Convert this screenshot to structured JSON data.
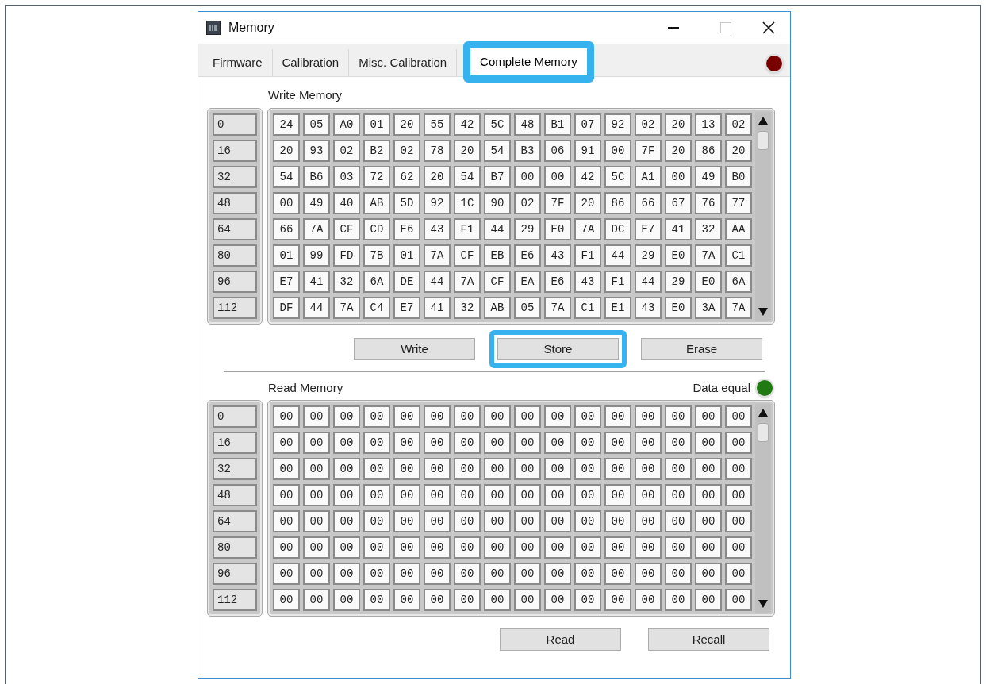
{
  "window": {
    "title": "Memory"
  },
  "tabs": [
    {
      "label": "Firmware",
      "selected": false,
      "highlighted": false
    },
    {
      "label": "Calibration",
      "selected": false,
      "highlighted": false
    },
    {
      "label": "Misc. Calibration",
      "selected": false,
      "highlighted": false
    },
    {
      "label": "Complete Memory",
      "selected": true,
      "highlighted": true
    }
  ],
  "connection_led": {
    "color": "#7a0000"
  },
  "write_memory": {
    "label": "Write Memory",
    "addresses": [
      "0",
      "16",
      "32",
      "48",
      "64",
      "80",
      "96",
      "112"
    ],
    "rows": [
      [
        "24",
        "05",
        "A0",
        "01",
        "20",
        "55",
        "42",
        "5C",
        "48",
        "B1",
        "07",
        "92",
        "02",
        "20",
        "13",
        "02"
      ],
      [
        "20",
        "93",
        "02",
        "B2",
        "02",
        "78",
        "20",
        "54",
        "B3",
        "06",
        "91",
        "00",
        "7F",
        "20",
        "86",
        "20"
      ],
      [
        "54",
        "B6",
        "03",
        "72",
        "62",
        "20",
        "54",
        "B7",
        "00",
        "00",
        "42",
        "5C",
        "A1",
        "00",
        "49",
        "B0"
      ],
      [
        "00",
        "49",
        "40",
        "AB",
        "5D",
        "92",
        "1C",
        "90",
        "02",
        "7F",
        "20",
        "86",
        "66",
        "67",
        "76",
        "77"
      ],
      [
        "66",
        "7A",
        "CF",
        "CD",
        "E6",
        "43",
        "F1",
        "44",
        "29",
        "E0",
        "7A",
        "DC",
        "E7",
        "41",
        "32",
        "AA"
      ],
      [
        "01",
        "99",
        "FD",
        "7B",
        "01",
        "7A",
        "CF",
        "EB",
        "E6",
        "43",
        "F1",
        "44",
        "29",
        "E0",
        "7A",
        "C1"
      ],
      [
        "E7",
        "41",
        "32",
        "6A",
        "DE",
        "44",
        "7A",
        "CF",
        "EA",
        "E6",
        "43",
        "F1",
        "44",
        "29",
        "E0",
        "6A"
      ],
      [
        "DF",
        "44",
        "7A",
        "C4",
        "E7",
        "41",
        "32",
        "AB",
        "05",
        "7A",
        "C1",
        "E1",
        "43",
        "E0",
        "3A",
        "7A"
      ]
    ]
  },
  "write_buttons": [
    {
      "label": "Write",
      "highlighted": false
    },
    {
      "label": "Store",
      "highlighted": true
    },
    {
      "label": "Erase",
      "highlighted": false
    }
  ],
  "read_memory": {
    "label": "Read Memory",
    "addresses": [
      "0",
      "16",
      "32",
      "48",
      "64",
      "80",
      "96",
      "112"
    ],
    "rows": [
      [
        "00",
        "00",
        "00",
        "00",
        "00",
        "00",
        "00",
        "00",
        "00",
        "00",
        "00",
        "00",
        "00",
        "00",
        "00",
        "00"
      ],
      [
        "00",
        "00",
        "00",
        "00",
        "00",
        "00",
        "00",
        "00",
        "00",
        "00",
        "00",
        "00",
        "00",
        "00",
        "00",
        "00"
      ],
      [
        "00",
        "00",
        "00",
        "00",
        "00",
        "00",
        "00",
        "00",
        "00",
        "00",
        "00",
        "00",
        "00",
        "00",
        "00",
        "00"
      ],
      [
        "00",
        "00",
        "00",
        "00",
        "00",
        "00",
        "00",
        "00",
        "00",
        "00",
        "00",
        "00",
        "00",
        "00",
        "00",
        "00"
      ],
      [
        "00",
        "00",
        "00",
        "00",
        "00",
        "00",
        "00",
        "00",
        "00",
        "00",
        "00",
        "00",
        "00",
        "00",
        "00",
        "00"
      ],
      [
        "00",
        "00",
        "00",
        "00",
        "00",
        "00",
        "00",
        "00",
        "00",
        "00",
        "00",
        "00",
        "00",
        "00",
        "00",
        "00"
      ],
      [
        "00",
        "00",
        "00",
        "00",
        "00",
        "00",
        "00",
        "00",
        "00",
        "00",
        "00",
        "00",
        "00",
        "00",
        "00",
        "00"
      ],
      [
        "00",
        "00",
        "00",
        "00",
        "00",
        "00",
        "00",
        "00",
        "00",
        "00",
        "00",
        "00",
        "00",
        "00",
        "00",
        "00"
      ]
    ]
  },
  "data_equal": {
    "label": "Data equal",
    "color": "#1f7a12"
  },
  "read_buttons": [
    {
      "label": "Read",
      "highlighted": false
    },
    {
      "label": "Recall",
      "highlighted": false
    }
  ]
}
